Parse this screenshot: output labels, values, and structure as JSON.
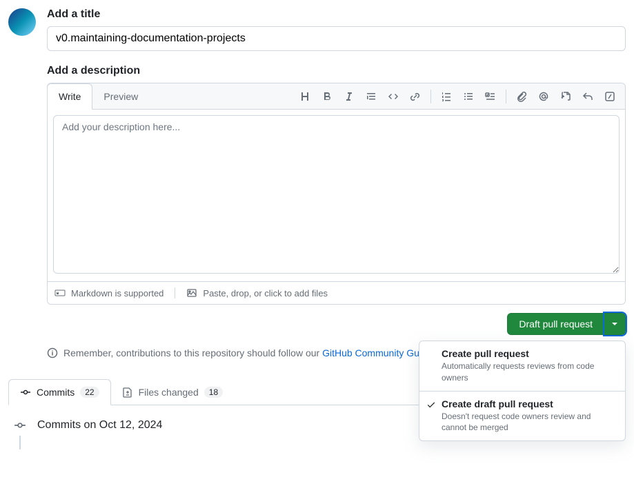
{
  "title": {
    "label": "Add a title",
    "value": "v0.maintaining-documentation-projects"
  },
  "description": {
    "label": "Add a description",
    "tabs": {
      "write": "Write",
      "preview": "Preview"
    },
    "placeholder": "Add your description here...",
    "footer": {
      "markdown": "Markdown is supported",
      "paste": "Paste, drop, or click to add files"
    }
  },
  "action": {
    "button": "Draft pull request",
    "options": [
      {
        "title": "Create pull request",
        "sub": "Automatically requests reviews from code owners",
        "selected": false
      },
      {
        "title": "Create draft pull request",
        "sub": "Doesn't request code owners review and cannot be merged",
        "selected": true
      }
    ]
  },
  "guidelines": {
    "prefix": "Remember, contributions to this repository should follow our ",
    "link": "GitHub Community Guidelines",
    "suffix": "."
  },
  "nav": {
    "commits": {
      "label": "Commits",
      "count": "22"
    },
    "files": {
      "label": "Files changed",
      "count": "18"
    }
  },
  "timeline": {
    "heading": "Commits on Oct 12, 2024"
  }
}
